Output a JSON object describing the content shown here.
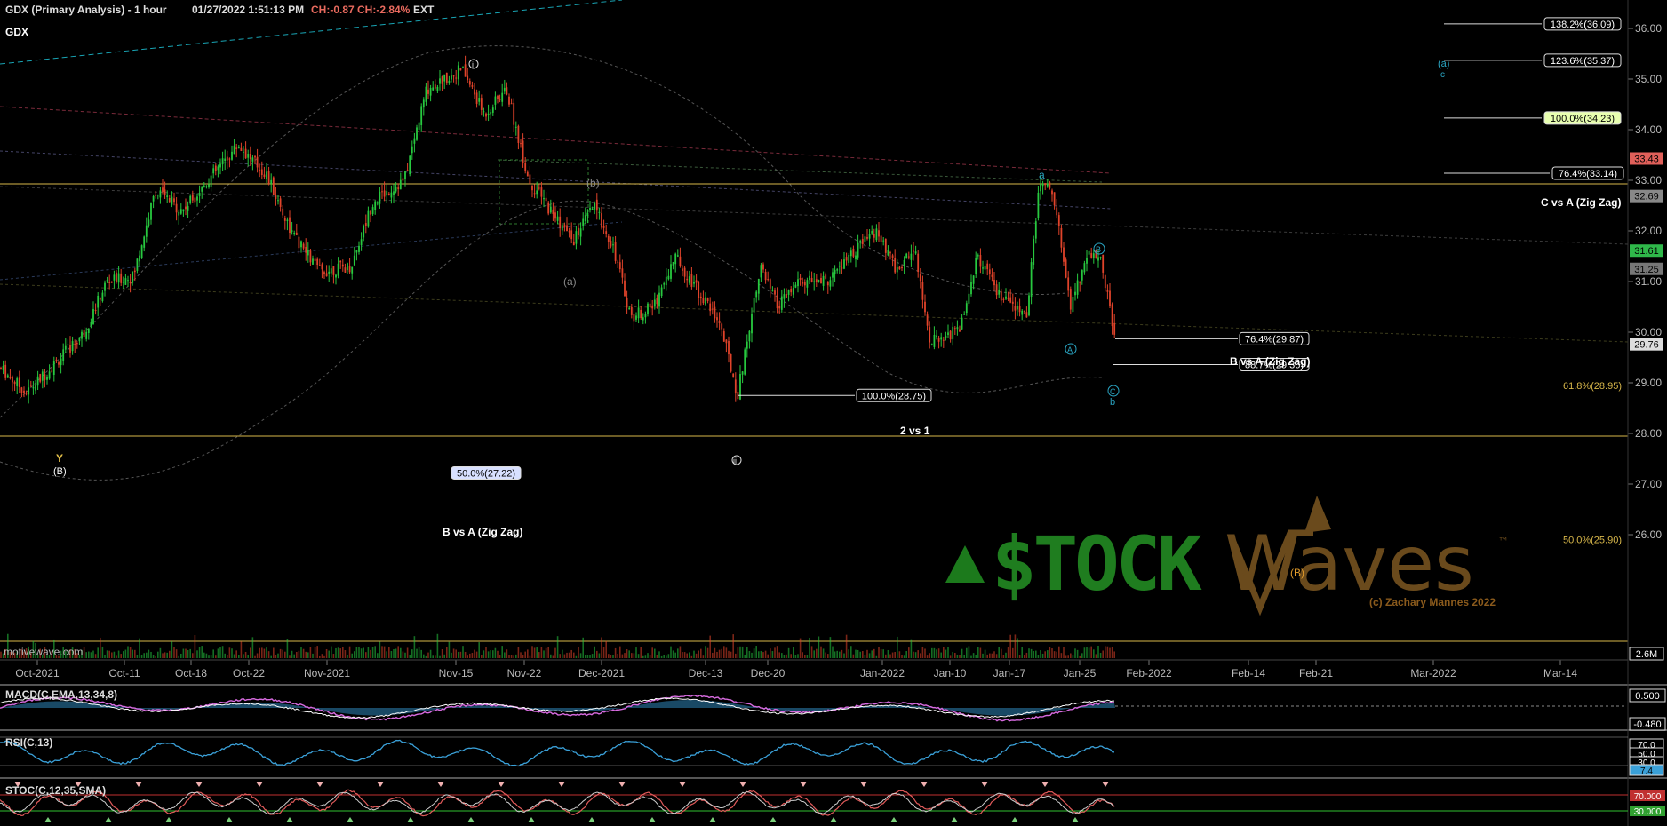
{
  "header": {
    "title": "GDX (Primary Analysis) - 1 hour",
    "datetime": "01/27/2022 1:51:13 PM",
    "change": "CH:-0.87",
    "change_pct": "CH:-2.84%",
    "session": "EXT",
    "symbol": "GDX"
  },
  "source": "motivewave.com",
  "watermark": {
    "brand_a": "$TOCK",
    "brand_b": "Waves",
    "tm": "™",
    "credit": "(c) Zachary Mannes 2022"
  },
  "colors": {
    "up": "#27c93f",
    "down": "#e0432a",
    "fib": "#d8b74a",
    "wave": "#2aa6c4",
    "macd": "#d86be0",
    "rsi": "#3aa0d8",
    "bg": "#000000"
  },
  "chart_data": {
    "type": "line",
    "title": "GDX (Primary Analysis) - 1 hour",
    "x": [
      "Oct-2021",
      "Oct-11",
      "Oct-18",
      "Oct-22",
      "Nov-2021",
      "Nov-15",
      "Nov-22",
      "Dec-2021",
      "Dec-13",
      "Dec-20",
      "Jan-2022",
      "Jan-10",
      "Jan-17",
      "Jan-25"
    ],
    "series": [
      {
        "values": [
          29.3,
          31.0,
          32.8,
          33.7,
          31.2,
          35.2,
          32.8,
          30.4,
          28.75,
          31.4,
          31.8,
          29.7,
          33.14,
          29.8
        ]
      }
    ],
    "x_ticks": [
      "Oct-2021",
      "Oct-11",
      "Oct-18",
      "Oct-22",
      "Nov-2021",
      "Nov-15",
      "Nov-22",
      "Dec-2021",
      "Dec-13",
      "Dec-20",
      "Jan-2022",
      "Jan-10",
      "Jan-17",
      "Jan-25",
      "Feb-2022",
      "Feb-14",
      "Feb-21",
      "Mar-2022",
      "Mar-14"
    ],
    "y_ticks": [
      "36.00",
      "35.00",
      "34.00",
      "33.00",
      "32.00",
      "31.00",
      "30.00",
      "29.00",
      "28.00",
      "27.00",
      "26.00"
    ],
    "ylim": [
      25.7,
      36.3
    ],
    "price_tags": [
      {
        "text": "33.43",
        "value": 33.43,
        "color": "#e0605a"
      },
      {
        "text": "32.69",
        "value": 32.69,
        "color": "#888888"
      },
      {
        "text": "31.61",
        "value": 31.61,
        "color": "#2fb84a"
      },
      {
        "text": "31.25",
        "value": 31.25,
        "color": "#777777"
      },
      {
        "text": "29.76",
        "value": 29.76,
        "color": "#dddddd"
      }
    ],
    "volume_tag": "2.6M",
    "fib_levels": [
      {
        "label": "138.2%(36.09)",
        "value": 36.09,
        "boxed": "#ffffff"
      },
      {
        "label": "123.6%(35.37)",
        "value": 35.37,
        "boxed": "#ffffff"
      },
      {
        "label": "100.0%(34.23)",
        "value": 34.23,
        "boxed": "#ffffff"
      },
      {
        "label": "76.4%(33.14)",
        "value": 33.14,
        "boxed": "#ffffff"
      },
      {
        "label": "76.4%(29.87)",
        "value": 29.87,
        "boxed": "#ffffff"
      },
      {
        "label": "88.7%(29.36)",
        "value": 29.36,
        "boxed": "#ffffff"
      },
      {
        "label": "100.0%(28.75)",
        "value": 28.75,
        "boxed": "#ffffff"
      },
      {
        "label": "50.0%(27.22)",
        "value": 27.22,
        "boxed": "#ffffff"
      },
      {
        "label": "61.8%(28.95)",
        "value": 28.95,
        "boxed": "none"
      },
      {
        "label": "50.0%(25.90)",
        "value": 25.9,
        "boxed": "none"
      }
    ],
    "annotations": [
      "C vs A (Zig Zag)",
      "B vs A (Zig Zag)",
      "2 vs 1",
      "B vs A (Zig Zag)"
    ],
    "wave_labels": [
      "Y",
      "(B)",
      "i",
      "ii",
      "(a)",
      "(b)",
      "a",
      "A",
      "B",
      "C",
      "b",
      "(a)",
      "c",
      "(B)"
    ]
  },
  "indicators": {
    "macd": {
      "label": "MACD(C,EMA,13,34,8)",
      "ticks": [
        "0.500",
        "-0.480"
      ]
    },
    "rsi": {
      "label": "RSI(C,13)",
      "ticks": [
        "70.0",
        "50.0",
        "30.0",
        "7.4"
      ]
    },
    "stoch": {
      "label": "STOC(C,12,35,SMA)",
      "ticks": [
        "70.000",
        "30.000"
      ]
    }
  }
}
